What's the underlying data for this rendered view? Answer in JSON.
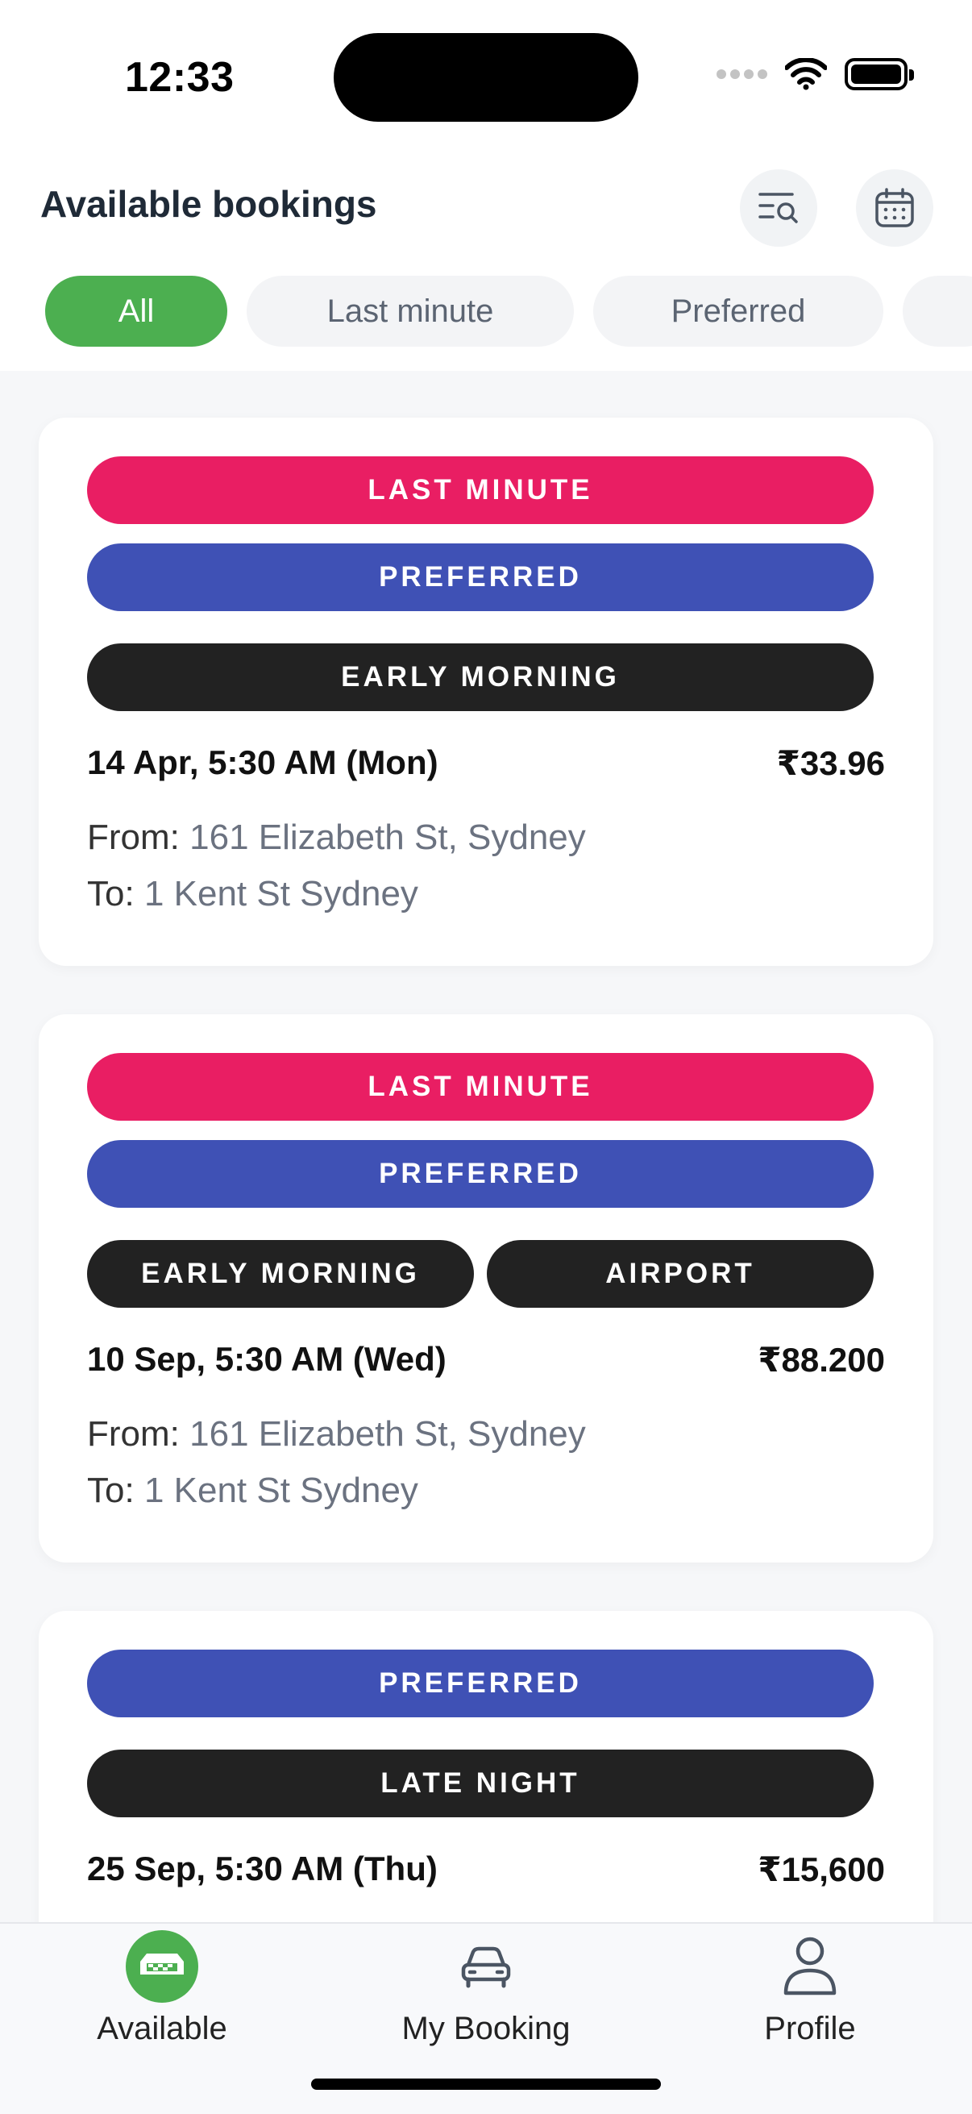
{
  "status_bar": {
    "time": "12:33"
  },
  "header": {
    "title": "Available bookings"
  },
  "icons": {
    "search_list": "search-list-icon",
    "calendar": "calendar-icon"
  },
  "filters": [
    {
      "label": "All",
      "active": true
    },
    {
      "label": "Last minute",
      "active": false
    },
    {
      "label": "Preferred",
      "active": false
    },
    {
      "label": "",
      "active": false
    }
  ],
  "bookings": [
    {
      "tags": [
        "LAST MINUTE",
        "PREFERRED",
        "EARLY MORNING"
      ],
      "datetime": "14 Apr, 5:30 AM (Mon)",
      "price": "₹33.96",
      "from_label": "From:",
      "from": "161 Elizabeth St, Sydney",
      "to_label": "To:",
      "to": "1 Kent St Sydney"
    },
    {
      "tags": [
        "LAST MINUTE",
        "PREFERRED",
        "EARLY MORNING",
        "AIRPORT"
      ],
      "datetime": "10 Sep, 5:30 AM (Wed)",
      "price": "₹88.200",
      "from_label": "From:",
      "from": "161 Elizabeth St, Sydney",
      "to_label": "To:",
      "to": "1 Kent St Sydney"
    },
    {
      "tags": [
        "PREFERRED",
        "LATE NIGHT"
      ],
      "datetime": "25 Sep, 5:30 AM (Thu)",
      "price": "₹15,600"
    }
  ],
  "bottom_nav": [
    {
      "label": "Available",
      "icon": "taxi-icon",
      "active": true
    },
    {
      "label": "My Booking",
      "icon": "car-icon",
      "active": false
    },
    {
      "label": "Profile",
      "icon": "profile-icon",
      "active": false
    }
  ],
  "colors": {
    "accent_green": "#4caf50",
    "last_minute": "#e91e63",
    "preferred": "#3f51b5",
    "time_tag": "#222222"
  }
}
